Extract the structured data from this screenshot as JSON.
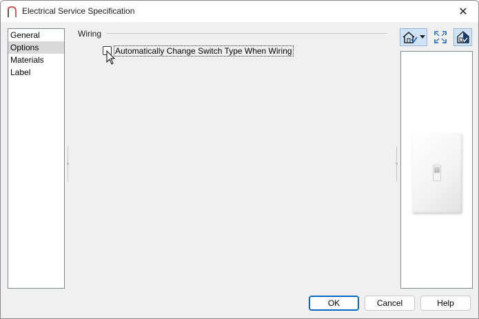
{
  "window": {
    "title": "Electrical Service Specification",
    "close_glyph": "✕"
  },
  "nav": {
    "items": [
      {
        "label": "General",
        "selected": false
      },
      {
        "label": "Options",
        "selected": true
      },
      {
        "label": "Materials",
        "selected": false
      },
      {
        "label": "Label",
        "selected": false
      }
    ]
  },
  "options": {
    "group_title": "Wiring",
    "auto_change_switch": {
      "label": "Automatically Change Switch Type When Wiring",
      "checked": false
    }
  },
  "preview_toolbar": {
    "view_icon": "house-view-icon",
    "dropdown_icon": "dropdown-arrow-icon",
    "fill_icon": "fill-window-icon",
    "plan_icon": "plan-view-icon"
  },
  "buttons": {
    "ok": "OK",
    "cancel": "Cancel",
    "help": "Help"
  },
  "colors": {
    "accent": "#0067c0",
    "selected_nav": "#d9d9d9",
    "toolbar_active": "#cfe3f7"
  }
}
